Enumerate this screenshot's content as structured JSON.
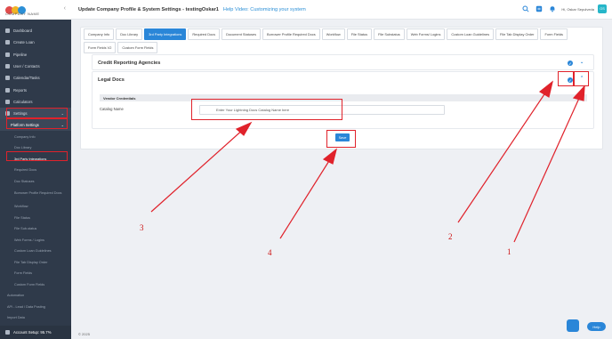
{
  "logo": {
    "text": "COMPANY NAME",
    "colors": [
      "#e04b4b",
      "#f0b323",
      "#2b8fd6"
    ]
  },
  "sidebar": {
    "items": [
      {
        "label": "Dashboard"
      },
      {
        "label": "Create Loan"
      },
      {
        "label": "Pipeline"
      },
      {
        "label": "User / Contacts"
      },
      {
        "label": "Calendar/Tasks"
      },
      {
        "label": "Reports"
      },
      {
        "label": "Calculators"
      },
      {
        "label": "Settings"
      }
    ],
    "platform_settings": "Platform Settings",
    "sub_items": [
      "Company Info",
      "Doc Library",
      "3rd Party Integrations",
      "Required Docs",
      "Doc Statuses",
      "Borrower Profile Required Docs",
      "Workflow",
      "File Status",
      "File Sub-status",
      "Web Forms / Logins",
      "Custom Loan Guidelines",
      "File Tab Display Order",
      "Form Fields",
      "Custom Form Fields"
    ],
    "bottom_items": [
      "Automation",
      "API - Lead / Data Posting",
      "Import Data",
      "Doc Wizard Tool"
    ],
    "account_setup": "Account Setup: 95.7%"
  },
  "topbar": {
    "title": "Update Company Profile & System Settings - testingOskar1",
    "help_video": "Help Video: Customizing your system",
    "user_name": "Hi, Oskar Sepulveda",
    "avatar_initials": "OS"
  },
  "tabs": [
    "Company Info",
    "Doc Library",
    "3rd Party Integrations",
    "Required Docs",
    "Document Statuses",
    "Borrower Profile Required Docs",
    "Workflow",
    "File Status",
    "File Substatus",
    "Web Forms/ Logins",
    "Custom Loan Guidelines",
    "File Tab Display Order",
    "Form Fields",
    "Form Fields V2",
    "Custom Form Fields"
  ],
  "panels": {
    "credit": "Credit Reporting Agencies",
    "legal": "Legal Docs"
  },
  "legal_form": {
    "section": "Vendor Credentials",
    "catalog_label": "Catalog Name",
    "catalog_placeholder": "Enter Your Lightning Docs Catalog Name here",
    "save": "Save"
  },
  "footer": "© 2025",
  "help_button": "Help",
  "annotations": {
    "n1": "1",
    "n2": "2",
    "n3": "3",
    "n4": "4"
  },
  "colors": {
    "accent": "#2a86d8",
    "annotation": "#e0222b",
    "sidebar": "#2f3a4a"
  }
}
